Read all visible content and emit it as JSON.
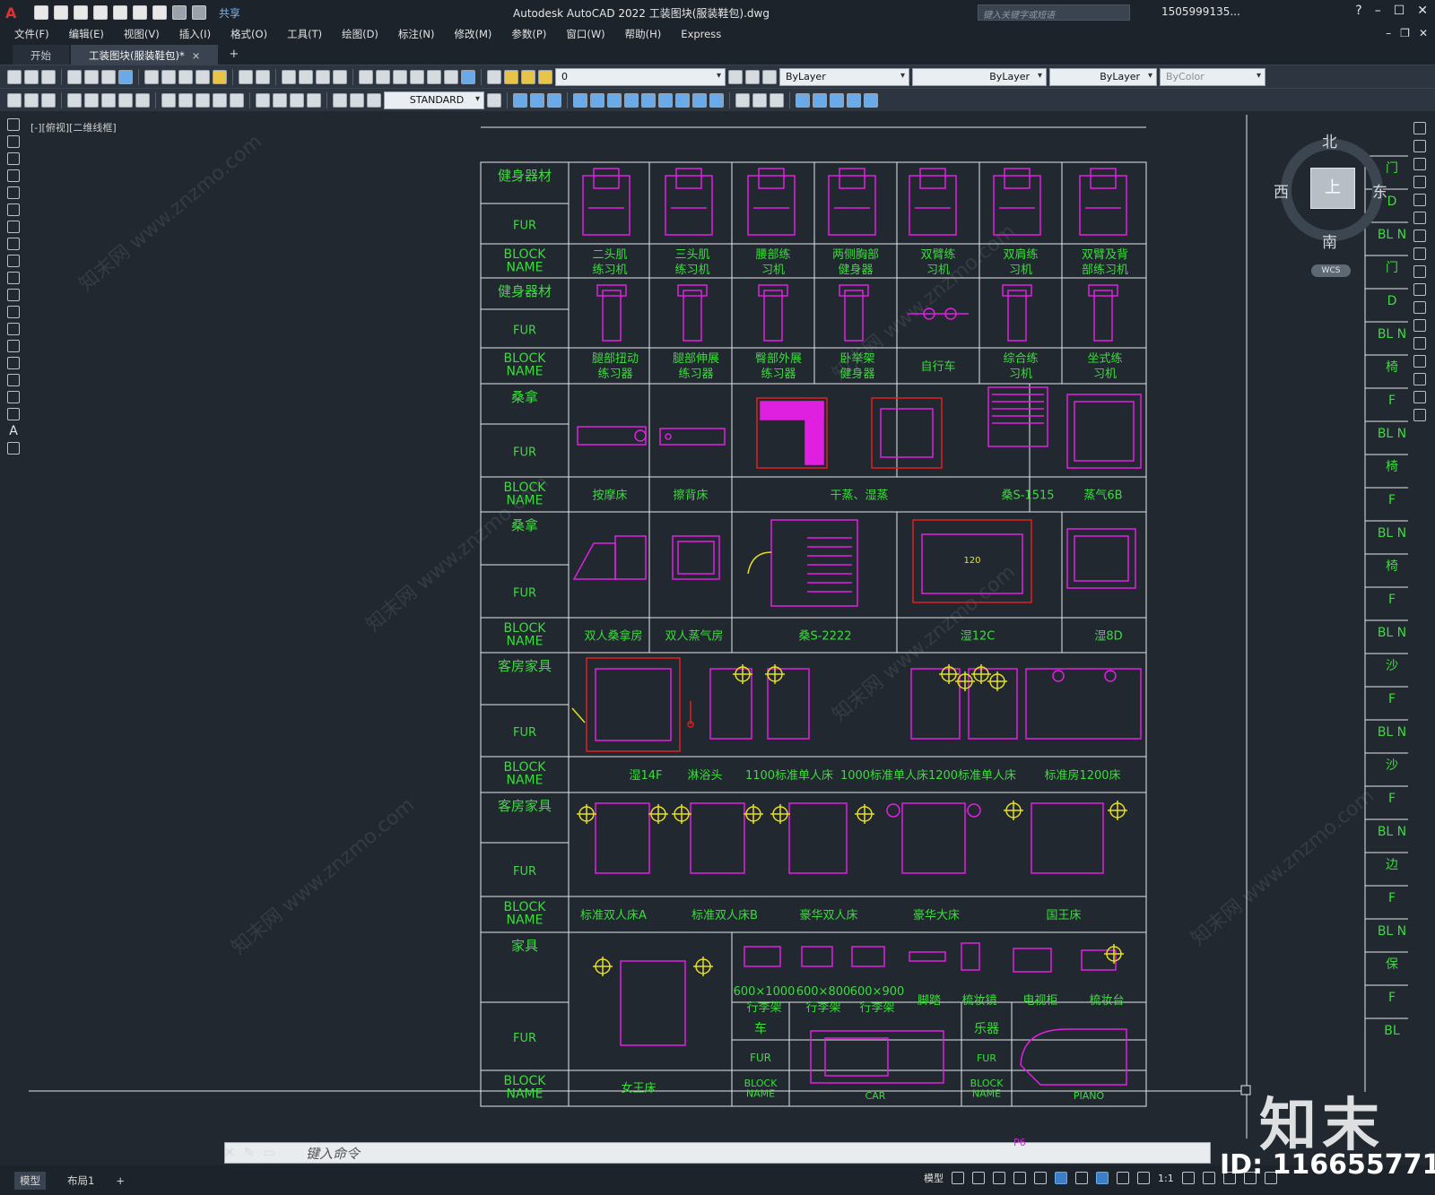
{
  "app": {
    "title": "Autodesk AutoCAD 2022    工装图块(服装鞋包).dwg",
    "share_label": "共享",
    "search_placeholder": "键入关键字或短语",
    "user": "1505999135...",
    "logo": "A"
  },
  "menu": {
    "items": [
      "文件(F)",
      "编辑(E)",
      "视图(V)",
      "插入(I)",
      "格式(O)",
      "工具(T)",
      "绘图(D)",
      "标注(N)",
      "修改(M)",
      "参数(P)",
      "窗口(W)",
      "帮助(H)",
      "Express"
    ]
  },
  "tabs": {
    "start": "开始",
    "active": "工装图块(服装鞋包)*",
    "close": "×",
    "add": "+"
  },
  "toolbar": {
    "layer_value": "0",
    "color_value": "ByLayer",
    "linetype_value": "ByLayer",
    "lineweight_value": "ByLayer",
    "plotstyle_value": "ByColor",
    "textstyle_value": "STANDARD"
  },
  "viewport": {
    "label": "[-][俯视][二维线框]"
  },
  "viewcube": {
    "north": "北",
    "south": "南",
    "east": "东",
    "west": "西",
    "top": "上",
    "wcs": "WCS"
  },
  "command": {
    "placeholder": "键入命令",
    "extra_text": "P6"
  },
  "status": {
    "model_tab": "模型",
    "layout_tab": "布局1",
    "add": "+",
    "model_label": "模型",
    "scale": "1:1"
  },
  "watermark": {
    "brand": "知末",
    "id": "ID: 1166557718",
    "site": "知末网 www.znzmo.com"
  },
  "drawing": {
    "rows": [
      {
        "category": "健身器材",
        "fur": "FUR",
        "block": "BLOCK NAME",
        "names": [
          "二头肌练习机",
          "三头肌练习机",
          "腰部练习机",
          "两侧胸部健身器",
          "双臂练习机",
          "双肩练习机",
          "双臂及背部练习机"
        ]
      },
      {
        "category": "健身器材",
        "fur": "FUR",
        "block": "BLOCK NAME",
        "names": [
          "腿部扭动练习器",
          "腿部伸展练习器",
          "臀部外展练习器",
          "卧举架健身器",
          "自行车",
          "综合练习机",
          "坐式练习机"
        ]
      },
      {
        "category": "桑拿",
        "fur": "FUR",
        "block": "BLOCK NAME",
        "names": [
          "按摩床",
          "擦背床",
          "干蒸、湿蒸",
          "桑S-1515",
          "蒸气6B"
        ]
      },
      {
        "category": "桑拿",
        "fur": "FUR",
        "block": "BLOCK NAME",
        "names": [
          "双人桑拿房",
          "双人蒸气房",
          "桑S-2222",
          "湿12C",
          "湿8D"
        ]
      },
      {
        "category": "客房家具",
        "fur": "FUR",
        "block": "BLOCK NAME",
        "names": [
          "湿14F",
          "淋浴头",
          "1100标准单人床",
          "1000标准单人床",
          "1200标准单人床",
          "标准房1200床"
        ]
      },
      {
        "category": "客房家具",
        "fur": "FUR",
        "block": "BLOCK NAME",
        "names": [
          "标准双人床A",
          "标准双人床B",
          "豪华双人床",
          "豪华大床",
          "国王床"
        ]
      },
      {
        "category": "家具",
        "fur": "FUR",
        "block": "BLOCK NAME",
        "names": [
          "女王床",
          "600×1000行李架",
          "600×800行李架",
          "600×900行李架",
          "脚踏",
          "梳妆镜",
          "电视柜",
          "梳妆台"
        ]
      }
    ],
    "sub_blocks": [
      {
        "category": "车",
        "fur": "FUR",
        "block": "BLOCK NAME",
        "name": "CAR"
      },
      {
        "category": "乐器",
        "fur": "FUR",
        "block": "BLOCK NAME",
        "name": "PIANO"
      }
    ],
    "inner_label": "120",
    "right_labels": [
      "门",
      "D",
      "BL N",
      "门",
      "D",
      "BL N",
      "椅",
      "F",
      "BL N",
      "椅",
      "F",
      "BL N",
      "椅",
      "F",
      "BL N",
      "沙",
      "F",
      "BL N",
      "沙",
      "F",
      "BL N",
      "边",
      "F",
      "BL N",
      "保",
      "F",
      "BL"
    ]
  },
  "colors": {
    "green": "#3cdc3c",
    "magenta": "#e020e0",
    "red": "#e02020",
    "yellow": "#e8e020",
    "white": "#e6e6e6"
  }
}
